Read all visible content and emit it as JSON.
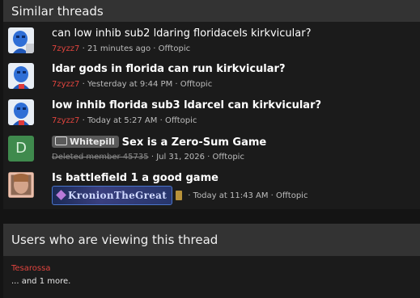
{
  "similar": {
    "header": "Similar threads",
    "threads": [
      {
        "title": "can low inhib sub2 ldaring floridacels kirkvicular?",
        "author": "7zyzz7",
        "time": "21 minutes ago",
        "forum": "Offtopic"
      },
      {
        "title": "ldar gods in florida can run kirkvicular?",
        "author": "7zyzz7",
        "time": "Yesterday at 9:44 PM",
        "forum": "Offtopic"
      },
      {
        "title": "low inhib florida sub3 ldarcel can kirkvicular?",
        "author": "7zyzz7",
        "time": "Today at 5:27 AM",
        "forum": "Offtopic"
      },
      {
        "avatar_letter": "D",
        "prefix": "Whitepill",
        "title": "Sex is a Zero-Sum Game",
        "author": "Deleted member 45735",
        "time": "Jul 31, 2026",
        "forum": "Offtopic"
      },
      {
        "title": "Is battlefield 1 a good game",
        "author": "KronionTheGreat",
        "time": "Today at 11:43 AM",
        "forum": "Offtopic"
      }
    ]
  },
  "viewing": {
    "header": "Users who are viewing this thread",
    "user": "Tesarossa",
    "more": "... and 1 more."
  },
  "sep": "·",
  "colors": {
    "username_red": "#e0443e",
    "avatar_green": "#3f8a4d",
    "header_bg": "#333333"
  }
}
